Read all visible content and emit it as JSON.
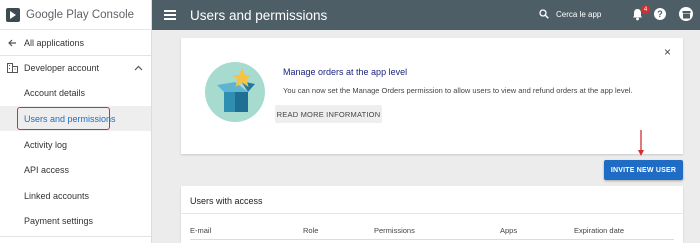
{
  "brand": {
    "name_part1": "Google Play",
    "name_part2": "Console"
  },
  "sidebar": {
    "back_label": "All applications",
    "section_label": "Developer account",
    "items": [
      {
        "label": "Account details"
      },
      {
        "label": "Users and permissions"
      },
      {
        "label": "Activity log"
      },
      {
        "label": "API access"
      },
      {
        "label": "Linked accounts"
      },
      {
        "label": "Payment settings"
      }
    ]
  },
  "header": {
    "title": "Users and permissions",
    "search_placeholder": "Cerca le app",
    "notification_count": "4",
    "help_icon_text": "?"
  },
  "promo": {
    "title": "Manage orders at the app level",
    "body": "You can now set the Manage Orders permission to allow users to view and refund orders at the app level.",
    "button_label": "READ MORE INFORMATION",
    "close_glyph": "×"
  },
  "invite_button_label": "INVITE NEW USER",
  "users": {
    "title": "Users with access",
    "columns": [
      "E-mail",
      "Role",
      "Permissions",
      "Apps",
      "Expiration date"
    ]
  },
  "colors": {
    "header_bg": "#4e5e66",
    "accent_blue": "#1e6cc4",
    "highlight_red": "#d32f2f",
    "promo_title": "#1a237e"
  }
}
